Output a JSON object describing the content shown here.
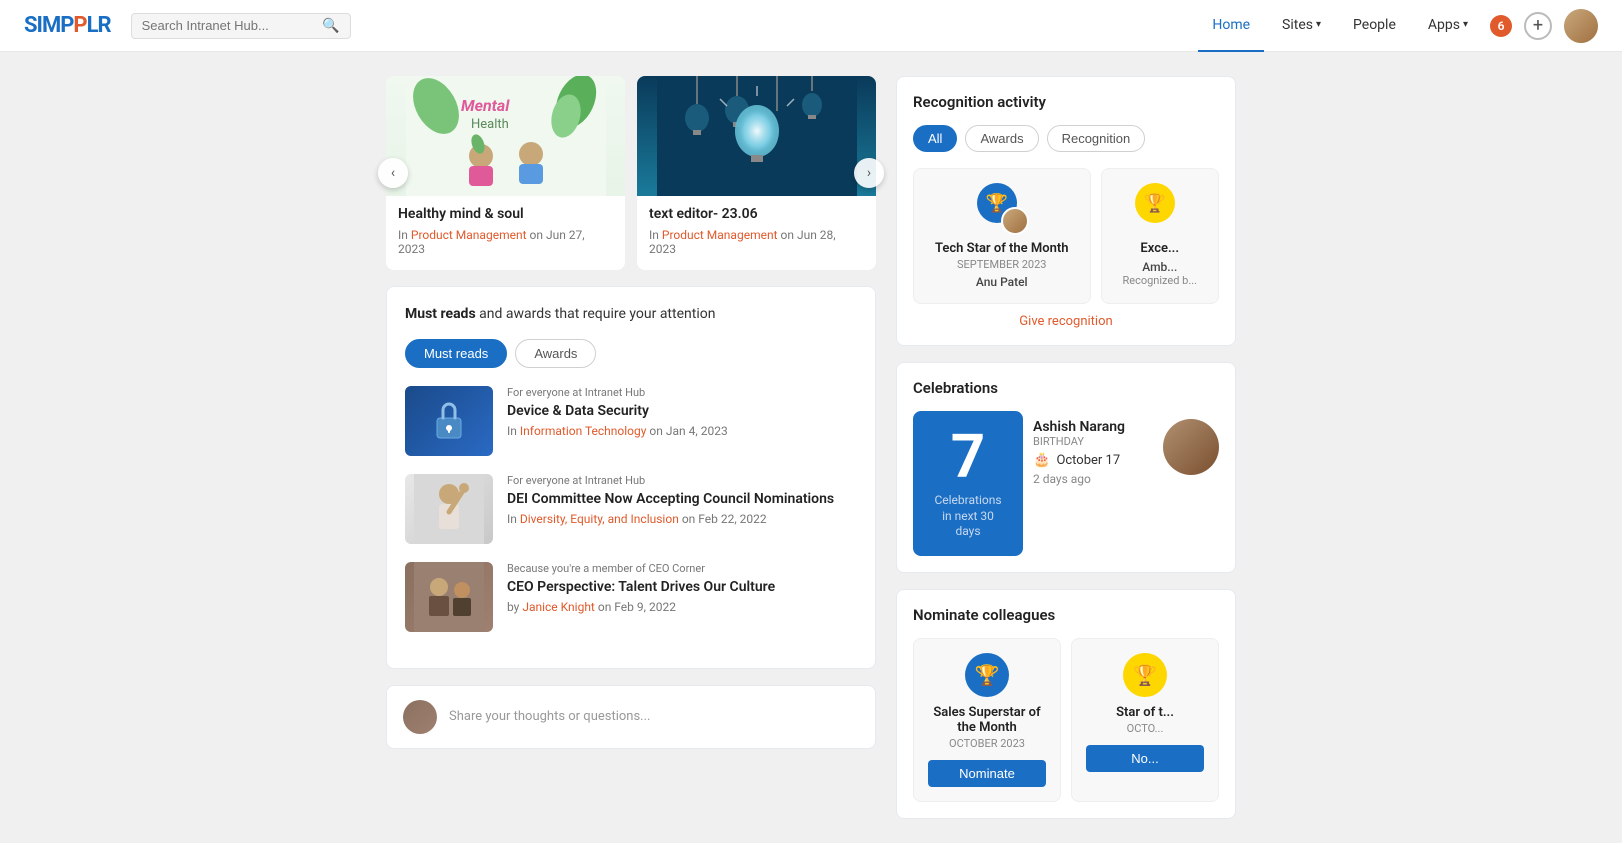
{
  "app": {
    "logo": "SIMPPLR",
    "logo_accent": "SIMPP"
  },
  "search": {
    "placeholder": "Search Intranet Hub..."
  },
  "nav": {
    "links": [
      {
        "id": "home",
        "label": "Home",
        "active": true,
        "hasDropdown": false
      },
      {
        "id": "sites",
        "label": "Sites",
        "active": false,
        "hasDropdown": true
      },
      {
        "id": "people",
        "label": "People",
        "active": false,
        "hasDropdown": false
      },
      {
        "id": "apps",
        "label": "Apps",
        "active": false,
        "hasDropdown": true
      }
    ],
    "notification_count": "6"
  },
  "carousel": {
    "cards": [
      {
        "id": "mental",
        "title": "Healthy mind & soul",
        "category": "Product Management",
        "date": "Jun 27, 2023"
      },
      {
        "id": "tech",
        "title": "text editor- 23.06",
        "category": "Product Management",
        "date": "Jun 28, 2023"
      }
    ]
  },
  "must_reads": {
    "header_prefix": "Must reads",
    "header_suffix": " and awards that require your attention",
    "tabs": [
      {
        "id": "must_reads",
        "label": "Must reads",
        "active": true
      },
      {
        "id": "awards",
        "label": "Awards",
        "active": false
      }
    ],
    "articles": [
      {
        "id": "device",
        "audience": "For everyone at Intranet Hub",
        "title": "Device & Data Security",
        "category": "Information Technology",
        "date": "Jan 4, 2023",
        "meta_prefix": "In"
      },
      {
        "id": "dei",
        "audience": "For everyone at Intranet Hub",
        "title": "DEI Committee Now Accepting Council Nominations",
        "category": "Diversity, Equity, and Inclusion",
        "date": "Feb 22, 2022",
        "meta_prefix": "In"
      },
      {
        "id": "ceo",
        "audience_prefix": "Because you're a member of",
        "audience_link": "CEO Corner",
        "title": "CEO Perspective: Talent Drives Our Culture",
        "author": "Janice Knight",
        "date": "Feb 9, 2022",
        "meta_prefix": "by"
      }
    ]
  },
  "share": {
    "placeholder": "Share your thoughts or questions..."
  },
  "recognition": {
    "title": "Recognition activity",
    "filters": [
      "All",
      "Awards",
      "Recognition"
    ],
    "active_filter": "All",
    "cards": [
      {
        "award": "Tech Star of the Month",
        "period": "September 2023",
        "person": "Anu Patel"
      },
      {
        "award": "Exce...",
        "period": "",
        "person": "Amb... Recognized b..."
      }
    ],
    "give_recognition_label": "Give recognition"
  },
  "celebrations": {
    "title": "Celebrations",
    "count": "7",
    "label_line1": "Celebrations",
    "label_line2": "in next 30 days",
    "person": {
      "name": "Ashish Narang",
      "type": "Birthday",
      "date": "October 17",
      "time_ago": "2 days ago"
    }
  },
  "nominate": {
    "title": "Nominate colleagues",
    "cards": [
      {
        "award": "Sales Superstar of the Month",
        "period": "October 2023",
        "btn": "Nominate"
      },
      {
        "award": "Star of t...",
        "period": "Octo...",
        "btn": "No..."
      }
    ]
  }
}
